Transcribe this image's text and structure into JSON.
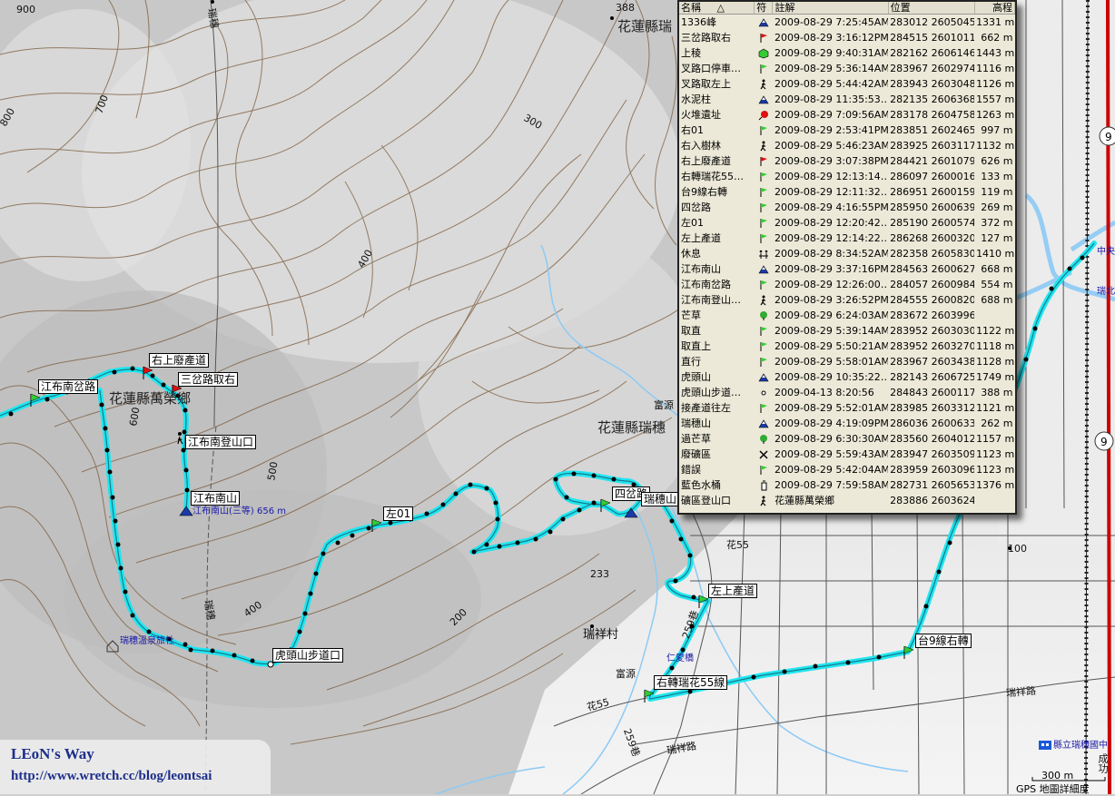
{
  "map": {
    "place_labels": {
      "hualien_wanrong": "花蓮縣萬榮鄉",
      "hualien_ruisui": "花蓮縣瑞穗",
      "hualien_ruisui_top": "花蓮縣瑞",
      "ruixiang_village": "瑞祥村",
      "fuyuan": "富源",
      "fuyuan2": "富源",
      "ruisui_hotspring": "瑞穗溫泉旅社",
      "renaiqiao": "仁愛橋",
      "school": "縣立瑞穗國中",
      "zhongyang": "中央",
      "ruibei": "瑞北",
      "fenglin": "成功"
    },
    "road_labels": {
      "hua55_a": "花55",
      "hua55_b": "花55",
      "lane259_a": "259巷",
      "lane259_b": "259巷",
      "ruixiang_rd_a": "瑞祥路",
      "ruixiang_rd_b": "瑞祥路",
      "ruisui_rd_a": "瑞穗",
      "ruisui_rd_b": "瑞穗",
      "route9_a": "9",
      "route9_b": "9"
    },
    "contour_labels": [
      "900",
      "800",
      "700",
      "600",
      "500",
      "400",
      "400",
      "300",
      "200",
      "100",
      "388",
      "233"
    ],
    "waypoint_labels": {
      "right_waste_road": "右上廢產道",
      "sancha_right": "三岔路取右",
      "jiangbu_south_fork": "江布南岔路",
      "jiangbu_trailhead": "江布南登山口",
      "jiangbu_south_mtn": "江布南山",
      "jiangbu_peak_note": "江布南山(三等) 656 m",
      "left01": "左01",
      "sicha": "四岔路",
      "ruisui_mtn": "瑞穗山",
      "left_road": "左上產道",
      "hutoushan_trailhead": "虎頭山步道口",
      "tai9_right": "台9線右轉",
      "right_hua55": "右轉瑞花55線"
    },
    "colors": {
      "track": "#1ee6f0",
      "track_dot": "#000000",
      "water": "#8ccaf5",
      "road_red": "#cc0000",
      "flag_green": "#33cc33",
      "flag_red": "#dd1111",
      "peak_blue": "#1a3aa8"
    }
  },
  "waypoint_list": {
    "columns": [
      "名稱",
      "符",
      "註解",
      "位置",
      "高程"
    ],
    "sort_indicator": "△",
    "rows": [
      {
        "name": "1336峰",
        "sym": "peak",
        "note": "2009-08-29 7:25:45AM",
        "pos": "283012 2605045",
        "elev": "1331 m"
      },
      {
        "name": "三岔路取右",
        "sym": "flag-red",
        "note": "2009-08-29 3:16:12PM",
        "pos": "284515 2601011",
        "elev": "662 m"
      },
      {
        "name": "上稜",
        "sym": "cube",
        "note": "2009-08-29 9:40:31AM",
        "pos": "282162 2606146",
        "elev": "1443 m"
      },
      {
        "name": "叉路口停車…",
        "sym": "flag-green",
        "note": "2009-08-29 5:36:14AM",
        "pos": "283967 2602974",
        "elev": "1116 m"
      },
      {
        "name": "叉路取左上",
        "sym": "hiker",
        "note": "2009-08-29 5:44:42AM",
        "pos": "283943 2603048",
        "elev": "1126 m"
      },
      {
        "name": "水泥柱",
        "sym": "peak",
        "note": "2009-08-29 11:35:53…",
        "pos": "282135 2606368",
        "elev": "1557 m"
      },
      {
        "name": "火堆遺址",
        "sym": "pin-red",
        "note": "2009-08-29 7:09:56AM",
        "pos": "283178 2604758",
        "elev": "1263 m"
      },
      {
        "name": "右01",
        "sym": "flag-green",
        "note": "2009-08-29 2:53:41PM",
        "pos": "283851 2602465",
        "elev": "997 m"
      },
      {
        "name": "右入樹林",
        "sym": "hiker",
        "note": "2009-08-29 5:46:23AM",
        "pos": "283925 2603117",
        "elev": "1132 m"
      },
      {
        "name": "右上廢產道",
        "sym": "flag-red",
        "note": "2009-08-29 3:07:38PM",
        "pos": "284421 2601079",
        "elev": "626 m"
      },
      {
        "name": "右轉瑞花55…",
        "sym": "flag-green",
        "note": "2009-08-29 12:13:14…",
        "pos": "286097 2600016",
        "elev": "133 m"
      },
      {
        "name": "台9線右轉",
        "sym": "flag-green",
        "note": "2009-08-29 12:11:32…",
        "pos": "286951 2600159",
        "elev": "119 m"
      },
      {
        "name": "四岔路",
        "sym": "flag-green",
        "note": "2009-08-29 4:16:55PM",
        "pos": "285950 2600639",
        "elev": "269 m"
      },
      {
        "name": "左01",
        "sym": "flag-green",
        "note": "2009-08-29 12:20:42…",
        "pos": "285190 2600574",
        "elev": "372 m"
      },
      {
        "name": "左上產道",
        "sym": "flag-green",
        "note": "2009-08-29 12:14:22…",
        "pos": "286268 2600320",
        "elev": "127 m"
      },
      {
        "name": "休息",
        "sym": "rest",
        "note": "2009-08-29 8:34:52AM",
        "pos": "282358 2605830",
        "elev": "1410 m"
      },
      {
        "name": "江布南山",
        "sym": "peak",
        "note": "2009-08-29 3:37:16PM",
        "pos": "284563 2600627",
        "elev": "668 m"
      },
      {
        "name": "江布南岔路",
        "sym": "flag-green",
        "note": "2009-08-29 12:26:00…",
        "pos": "284057 2600984",
        "elev": "554 m"
      },
      {
        "name": "江布南登山…",
        "sym": "hiker",
        "note": "2009-08-29 3:26:52PM",
        "pos": "284555 2600820",
        "elev": "688 m"
      },
      {
        "name": "芒草",
        "sym": "tree",
        "note": "2009-08-29 6:24:03AM",
        "pos": "283672 2603996",
        "elev": ""
      },
      {
        "name": "取直",
        "sym": "flag-green",
        "note": "2009-08-29 5:39:14AM",
        "pos": "283952 2603030",
        "elev": "1122 m"
      },
      {
        "name": "取直上",
        "sym": "flag-green",
        "note": "2009-08-29 5:50:21AM",
        "pos": "283952 2603270",
        "elev": "1118 m"
      },
      {
        "name": "直行",
        "sym": "flag-green",
        "note": "2009-08-29 5:58:01AM",
        "pos": "283967 2603438",
        "elev": "1128 m"
      },
      {
        "name": "虎頭山",
        "sym": "peak",
        "note": "2009-08-29 10:35:22…",
        "pos": "282143 2606725",
        "elev": "1749 m"
      },
      {
        "name": "虎頭山步道…",
        "sym": "dot",
        "note": "2009-04-13 8:20:56",
        "pos": "284843 2600117",
        "elev": "388 m"
      },
      {
        "name": "接產道往左",
        "sym": "flag-green",
        "note": "2009-08-29 5:52:01AM",
        "pos": "283985 2603312",
        "elev": "1121 m"
      },
      {
        "name": "瑞穗山",
        "sym": "peak",
        "note": "2009-08-29 4:19:09PM",
        "pos": "286036 2600633",
        "elev": "262 m"
      },
      {
        "name": "過芒草",
        "sym": "tree",
        "note": "2009-08-29 6:30:30AM",
        "pos": "283560 2604012",
        "elev": "1157 m"
      },
      {
        "name": "廢礦區",
        "sym": "pick",
        "note": "2009-08-29 5:59:43AM",
        "pos": "283947 2603509",
        "elev": "1123 m"
      },
      {
        "name": "錯誤",
        "sym": "flag-green",
        "note": "2009-08-29 5:42:04AM",
        "pos": "283959 2603096",
        "elev": "1123 m"
      },
      {
        "name": "藍色水桶",
        "sym": "drink",
        "note": "2009-08-29 7:59:58AM",
        "pos": "282731 2605653",
        "elev": "1376 m"
      },
      {
        "name": "礦區登山口",
        "sym": "hiker",
        "note": "花蓮縣萬榮鄉",
        "pos": "283886 2603624",
        "elev": ""
      }
    ]
  },
  "logo": {
    "title": "LEoN's Way",
    "url": "http://www.wretch.cc/blog/leontsai"
  },
  "scale": {
    "label": "300 m",
    "caption": "GPS 地圖詳細度"
  }
}
